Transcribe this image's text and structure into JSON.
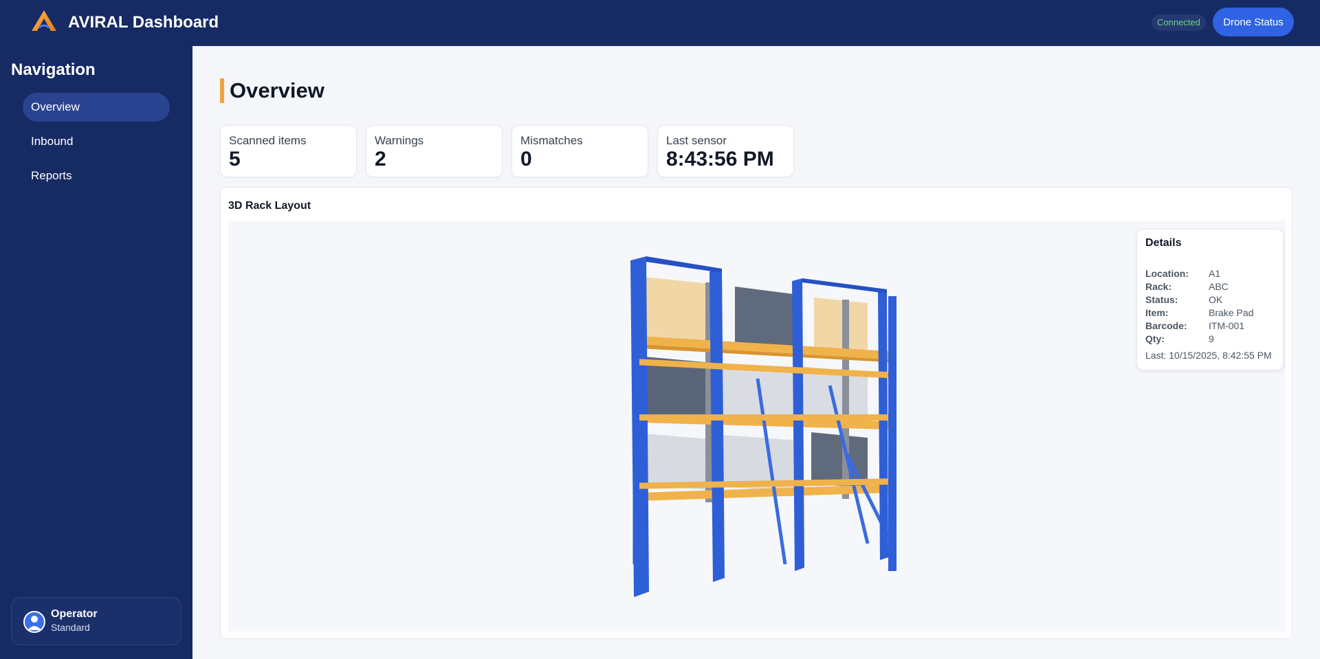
{
  "app": {
    "title": "AVIRAL Dashboard",
    "connection_status": "Connected",
    "drone_button": "Drone Status"
  },
  "sidebar": {
    "title": "Navigation",
    "items": [
      {
        "label": "Overview",
        "active": true
      },
      {
        "label": "Inbound",
        "active": false
      },
      {
        "label": "Reports",
        "active": false
      }
    ],
    "user": {
      "name": "Operator",
      "role": "Standard"
    }
  },
  "main": {
    "title": "Overview",
    "stats": [
      {
        "label": "Scanned items",
        "value": "5"
      },
      {
        "label": "Warnings",
        "value": "2"
      },
      {
        "label": "Mismatches",
        "value": "0"
      },
      {
        "label": "Last sensor",
        "value": "8:43:56 PM"
      }
    ],
    "rack": {
      "title": "3D Rack Layout",
      "details": {
        "title": "Details",
        "fields": [
          {
            "key": "Location:",
            "value": "A1"
          },
          {
            "key": "Rack:",
            "value": "ABC"
          },
          {
            "key": "Status:",
            "value": "OK"
          },
          {
            "key": "Item:",
            "value": "Brake Pad"
          },
          {
            "key": "Barcode:",
            "value": "ITM-001"
          },
          {
            "key": "Qty:",
            "value": "9"
          }
        ],
        "last": "Last: 10/15/2025, 8:42:55 PM"
      }
    }
  },
  "colors": {
    "navy": "#162a63",
    "accent": "#f0a33c",
    "primary": "#2f63e3",
    "rack_upright": "#2f5fd6",
    "rack_beam": "#f0b24a"
  }
}
